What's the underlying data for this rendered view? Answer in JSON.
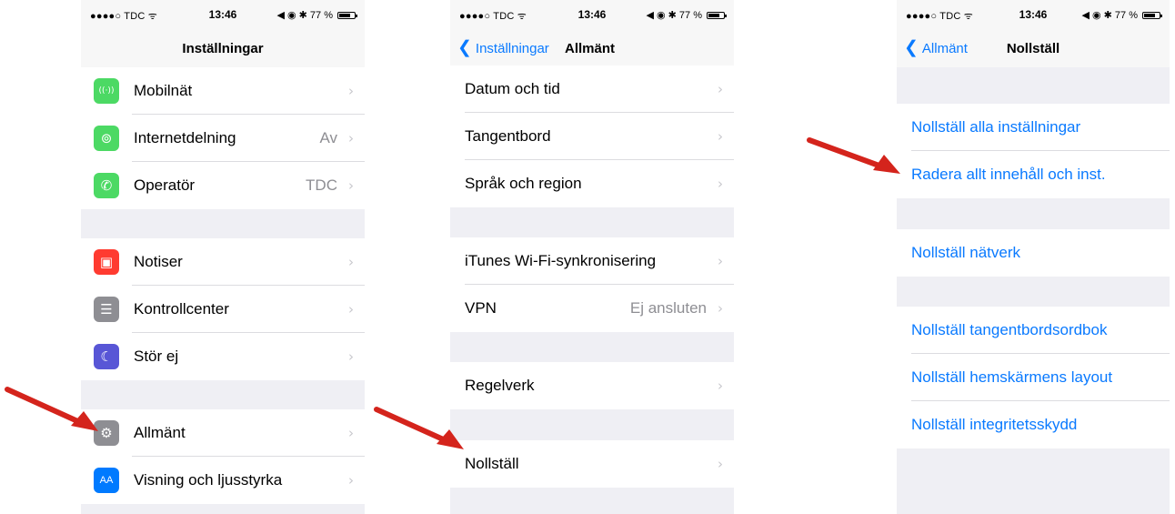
{
  "status": {
    "carrier": "●●●●○ TDC ᯤ",
    "time": "13:46",
    "indicators": "◀ ◉ ✱ 77 %",
    "battery_level": 0.77
  },
  "screen1": {
    "title": "Inställningar",
    "groups": [
      [
        {
          "label": "Mobilnät",
          "value": "",
          "icon": "antenna-icon",
          "color": "#4cd964"
        },
        {
          "label": "Internetdelning",
          "value": "Av",
          "icon": "hotspot-icon",
          "color": "#4cd964"
        },
        {
          "label": "Operatör",
          "value": "TDC",
          "icon": "phone-icon",
          "color": "#4cd964"
        }
      ],
      [
        {
          "label": "Notiser",
          "value": "",
          "icon": "notifications-icon",
          "color": "#ff3b30"
        },
        {
          "label": "Kontrollcenter",
          "value": "",
          "icon": "control-center-icon",
          "color": "#8e8e93"
        },
        {
          "label": "Stör ej",
          "value": "",
          "icon": "moon-icon",
          "color": "#5856d6"
        }
      ],
      [
        {
          "label": "Allmänt",
          "value": "",
          "icon": "gear-icon",
          "color": "#8e8e93"
        },
        {
          "label": "Visning och ljusstyrka",
          "value": "",
          "icon": "text-size-icon",
          "color": "#007aff",
          "icon_text": "AA"
        }
      ]
    ]
  },
  "screen2": {
    "back": "Inställningar",
    "title": "Allmänt",
    "groups": [
      [
        {
          "label": "Datum och tid",
          "value": ""
        },
        {
          "label": "Tangentbord",
          "value": ""
        },
        {
          "label": "Språk och region",
          "value": ""
        }
      ],
      [
        {
          "label": "iTunes Wi-Fi-synkronisering",
          "value": ""
        },
        {
          "label": "VPN",
          "value": "Ej ansluten"
        }
      ],
      [
        {
          "label": "Regelverk",
          "value": ""
        }
      ],
      [
        {
          "label": "Nollställ",
          "value": ""
        }
      ]
    ]
  },
  "screen3": {
    "back": "Allmänt",
    "title": "Nollställ",
    "groups": [
      [
        {
          "label": "Nollställ alla inställningar"
        },
        {
          "label": "Radera allt innehåll och inst."
        }
      ],
      [
        {
          "label": "Nollställ nätverk"
        }
      ],
      [
        {
          "label": "Nollställ tangentbordsordbok"
        },
        {
          "label": "Nollställ hemskärmens layout"
        },
        {
          "label": "Nollställ integritetsskydd"
        }
      ]
    ]
  },
  "colors": {
    "accent": "#0a7aff",
    "arrow": "#d4241c",
    "background": "#efeff4"
  }
}
